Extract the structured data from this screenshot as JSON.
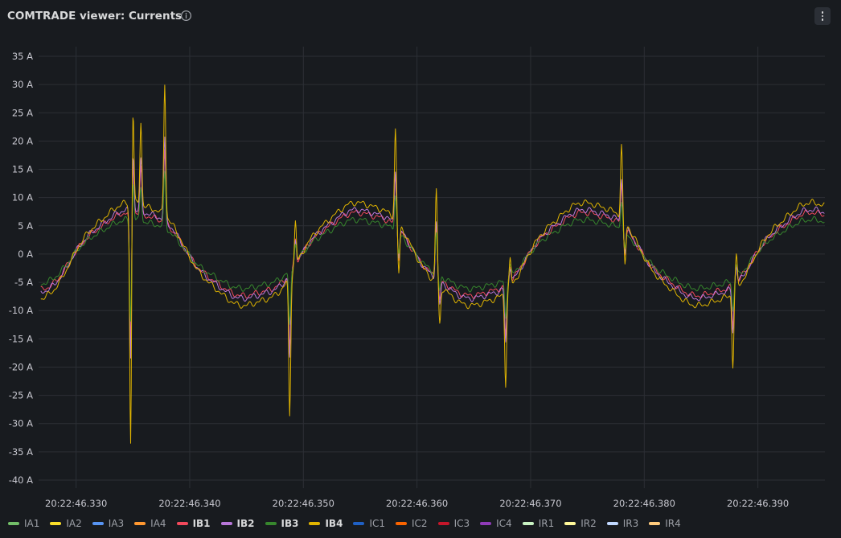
{
  "panel": {
    "title": "COMTRADE viewer: Currents"
  },
  "icons": {
    "info": "info-circle-icon",
    "menu": "more-vertical-icon"
  },
  "colors": {
    "background": "#181b1f",
    "grid": "#2c2f35",
    "axis_text": "#c7c7cf"
  },
  "chart_data": {
    "type": "line",
    "yunit": "A",
    "ylim": [
      -40,
      35
    ],
    "yticks": [
      35,
      30,
      25,
      20,
      15,
      10,
      5,
      0,
      -5,
      -10,
      -15,
      -20,
      -25,
      -30,
      -35,
      -40
    ],
    "ytick_labels": [
      "35 A",
      "30 A",
      "25 A",
      "20 A",
      "15 A",
      "10 A",
      "5 A",
      "0 A",
      "-5 A",
      "-10 A",
      "-15 A",
      "-20 A",
      "-25 A",
      "-30 A",
      "-35 A",
      "-40 A"
    ],
    "xlim_ms": [
      326.7,
      395.9
    ],
    "xtick_ms": [
      330,
      340,
      350,
      360,
      370,
      380,
      390
    ],
    "xtick_labels": [
      "20:22:46.330",
      "20:22:46.340",
      "20:22:46.350",
      "20:22:46.360",
      "20:22:46.370",
      "20:22:46.380",
      "20:22:46.390"
    ],
    "grid": true,
    "legend_position": "bottom",
    "series": [
      {
        "name": "IA1",
        "color": "#73bf69",
        "visible": false,
        "bold": false
      },
      {
        "name": "IA2",
        "color": "#fade2a",
        "visible": false,
        "bold": false
      },
      {
        "name": "IA3",
        "color": "#5794f2",
        "visible": false,
        "bold": false
      },
      {
        "name": "IA4",
        "color": "#ff9830",
        "visible": false,
        "bold": false
      },
      {
        "name": "IB1",
        "color": "#f2495c",
        "visible": true,
        "bold": true,
        "amp": 7.6,
        "spike": 1.0
      },
      {
        "name": "IB2",
        "color": "#b877d9",
        "visible": true,
        "bold": true,
        "amp": 8.1,
        "spike": 1.1
      },
      {
        "name": "IB3",
        "color": "#37872d",
        "visible": true,
        "bold": true,
        "amp": 6.3,
        "spike": 0.75
      },
      {
        "name": "IB4",
        "color": "#e0b400",
        "visible": true,
        "bold": true,
        "amp": 9.4,
        "spike": 1.8
      },
      {
        "name": "IC1",
        "color": "#1f60c4",
        "visible": false,
        "bold": false
      },
      {
        "name": "IC2",
        "color": "#fa6400",
        "visible": false,
        "bold": false
      },
      {
        "name": "IC3",
        "color": "#c4162a",
        "visible": false,
        "bold": false
      },
      {
        "name": "IC4",
        "color": "#8f3bb8",
        "visible": false,
        "bold": false
      },
      {
        "name": "IR1",
        "color": "#c8f2c2",
        "visible": false,
        "bold": false
      },
      {
        "name": "IR2",
        "color": "#fff899",
        "visible": false,
        "bold": false
      },
      {
        "name": "IR3",
        "color": "#c0d8ff",
        "visible": false,
        "bold": false
      },
      {
        "name": "IR4",
        "color": "#ffcb7d",
        "visible": false,
        "bold": false
      }
    ],
    "waveform": {
      "period_ms": 20,
      "zero_cross_rising_ms": 330,
      "ib4_spikes": [
        {
          "t_ms": 334.8,
          "value": -34.5
        },
        {
          "t_ms": 335.0,
          "value": 27.0
        },
        {
          "t_ms": 335.7,
          "value": 23.5
        },
        {
          "t_ms": 337.8,
          "value": 30.3
        },
        {
          "t_ms": 348.8,
          "value": -28.5
        },
        {
          "t_ms": 349.3,
          "value": 5.8
        },
        {
          "t_ms": 358.1,
          "value": 22.0
        },
        {
          "t_ms": 358.4,
          "value": -3.5
        },
        {
          "t_ms": 361.7,
          "value": 11.5
        },
        {
          "t_ms": 362.0,
          "value": -12.5
        },
        {
          "t_ms": 367.8,
          "value": -23.0
        },
        {
          "t_ms": 368.2,
          "value": -1.0
        },
        {
          "t_ms": 378.0,
          "value": 19.3
        },
        {
          "t_ms": 378.3,
          "value": -2.0
        },
        {
          "t_ms": 387.8,
          "value": -19.8
        },
        {
          "t_ms": 388.1,
          "value": -0.5
        }
      ]
    }
  }
}
